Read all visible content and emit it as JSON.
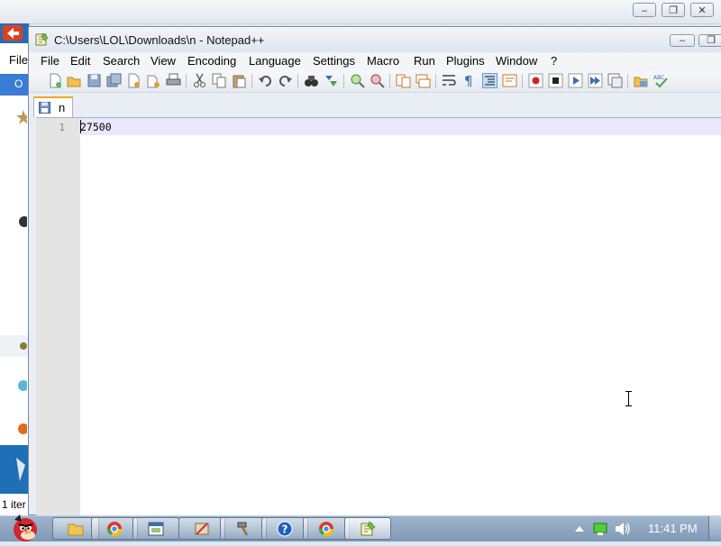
{
  "outer_window": {
    "menu_partial": "File",
    "tab_partial": "O",
    "status_partial": "1 iter"
  },
  "notepad": {
    "title": "C:\\Users\\LOL\\Downloads\\n - Notepad++",
    "menu": [
      "File",
      "Edit",
      "Search",
      "View",
      "Encoding",
      "Language",
      "Settings",
      "Macro",
      "Run",
      "Plugins",
      "Window",
      "?"
    ],
    "tab_label": "n",
    "line_number": "1",
    "content": "27500"
  },
  "taskbar": {
    "time": "11:41 PM"
  },
  "colors": {
    "current_line": "#e8e8ff",
    "tab_accent": "#f5a623",
    "gutter": "#e4e4e4"
  }
}
